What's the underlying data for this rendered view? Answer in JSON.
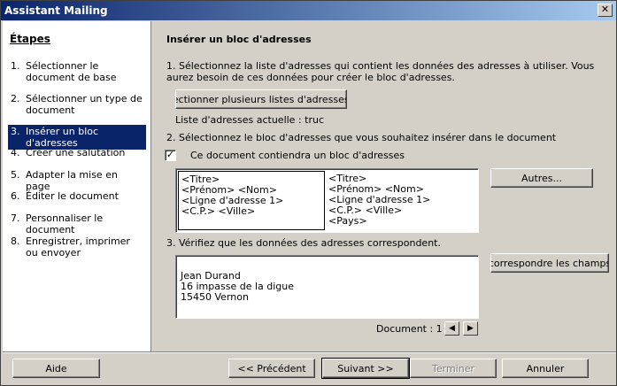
{
  "window": {
    "title": "Assistant Mailing",
    "close_label": "✕"
  },
  "steps": {
    "title": "Étapes",
    "items": [
      {
        "num": "1.",
        "label": "Sélectionner le document de base"
      },
      {
        "num": "2.",
        "label": "Sélectionner un type de document"
      },
      {
        "num": "3.",
        "label": "Insérer un bloc d'adresses"
      },
      {
        "num": "4.",
        "label": "Créer une salutation"
      },
      {
        "num": "5.",
        "label": "Adapter la mise en page"
      },
      {
        "num": "6.",
        "label": "Éditer le document"
      },
      {
        "num": "7.",
        "label": "Personnaliser le document"
      },
      {
        "num": "8.",
        "label": "Enregistrer, imprimer ou envoyer"
      }
    ]
  },
  "main": {
    "heading": "Insérer un bloc d'adresses",
    "step1_text": "1. Sélectionnez la liste d'adresses qui contient les données des adresses à utiliser. Vous aurez besoin de ces données pour créer le bloc d'adresses.",
    "select_lists_button": "électionner plusieurs listes d'adresses...",
    "current_list": "Liste d'adresses actuelle : truc",
    "step2_text": "2. Sélectionnez le bloc d'adresses que vous souhaitez insérer dans le document",
    "checkbox_label": "Ce document contiendra un bloc d'adresses",
    "checkbox_mark": "✓",
    "block1_lines": [
      "<Titre>",
      "<Prénom> <Nom>",
      "<Ligne d'adresse 1>",
      "<C.P.> <Ville>"
    ],
    "block2_lines": [
      "<Titre>",
      "<Prénom> <Nom>",
      "<Ligne d'adresse 1>",
      "<C.P.> <Ville>",
      "<Pays>"
    ],
    "more_button": "Autres...",
    "step3_text": "3. Vérifiez que les données des adresses correspondent.",
    "preview_lines": [
      "Jean Durand",
      "16 impasse de la digue",
      "15450 Vernon"
    ],
    "match_fields_button": "correspondre les champs",
    "document_counter": "Document : 1",
    "prev_arrow": "◀",
    "next_arrow": "▶"
  },
  "footer": {
    "help": "Aide",
    "previous": "<< Précédent",
    "next": "Suivant >>",
    "finish": "Terminer",
    "cancel": "Annuler"
  }
}
